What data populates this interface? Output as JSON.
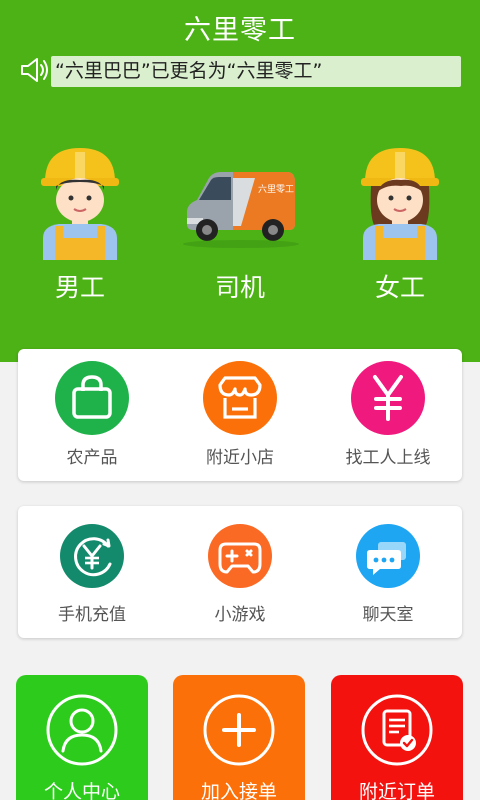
{
  "app": {
    "title": "六里零工"
  },
  "notice": {
    "text": "“六里巴巴”已更名为“六里零工”",
    "icon": "speaker-icon"
  },
  "categories": [
    {
      "label": "男工",
      "icon": "male-worker-icon"
    },
    {
      "label": "司机",
      "icon": "delivery-van-icon"
    },
    {
      "label": "女工",
      "icon": "female-worker-icon"
    }
  ],
  "services_row1": [
    {
      "label": "农产品",
      "icon": "shopping-bag-icon",
      "color": "#1fb24a"
    },
    {
      "label": "附近小店",
      "icon": "store-icon",
      "color": "#fb7008"
    },
    {
      "label": "找工人上线",
      "icon": "yen-icon",
      "color": "#f0197d"
    }
  ],
  "services_row2": [
    {
      "label": "手机充值",
      "icon": "recharge-icon",
      "color": "#148a6c"
    },
    {
      "label": "小游戏",
      "icon": "gamepad-icon",
      "color": "#fb6a25"
    },
    {
      "label": "聊天室",
      "icon": "chat-icon",
      "color": "#1ea6f3"
    }
  ],
  "bottom_tiles": [
    {
      "label": "个人中心",
      "icon": "user-icon",
      "color": "#2dcc1c"
    },
    {
      "label": "加入接单",
      "icon": "plus-icon",
      "color": "#fb7008"
    },
    {
      "label": "附近订单",
      "icon": "order-list-icon",
      "color": "#f4120f"
    }
  ],
  "colors": {
    "header_bg": "#4db216",
    "notice_bg": "#d9efcd"
  }
}
